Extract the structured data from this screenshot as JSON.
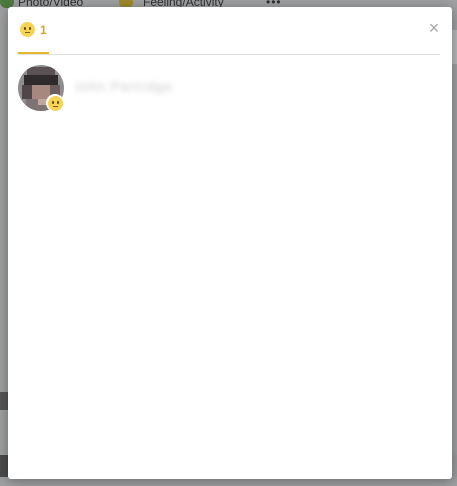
{
  "colors": {
    "accent": "#e8b72d",
    "count_text": "#d7a720",
    "emoji_face": "#f7d353",
    "close": "#a6a8ac",
    "divider": "#e1e3e6"
  },
  "background": {
    "composer_options": [
      "Photo/Video",
      "Feeling/Activity",
      "•••"
    ]
  },
  "dialog": {
    "close_label": "×",
    "tabs": [
      {
        "icon": "wow-reaction-icon",
        "count": "1",
        "active": true
      }
    ],
    "reactors": [
      {
        "name": "John Partridge",
        "reaction_icon": "wow-reaction-icon"
      }
    ]
  }
}
